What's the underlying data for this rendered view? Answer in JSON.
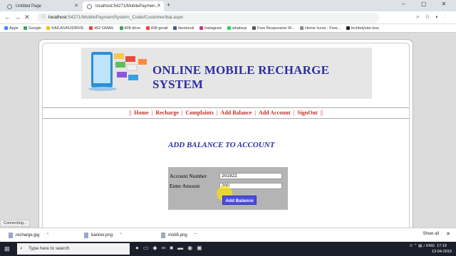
{
  "browser": {
    "tabs": [
      {
        "title": "Untitled Page",
        "active": false
      },
      {
        "title": "localhost:54271/MobilePaymen...",
        "active": true
      }
    ],
    "new_tab": "+",
    "window_controls": [
      "–",
      "▢",
      "✕"
    ],
    "url_host": "localhost",
    "url_rest": ":54271/MobilePaymentSystem_Code/Customer/bal.aspx",
    "nav_icons": [
      "search-icon",
      "star-icon",
      "extension-icon",
      "menu-icon"
    ],
    "bookmarks": [
      {
        "label": "Apps",
        "color": "#4285f4"
      },
      {
        "label": "Google",
        "color": "#34a853"
      },
      {
        "label": "KAILAS452DRIVE",
        "color": "#fbbc05"
      },
      {
        "label": "452 GMAIL",
        "color": "#ea4335"
      },
      {
        "label": "408 drive",
        "color": "#34a853"
      },
      {
        "label": "408 gmail",
        "color": "#ea4335"
      },
      {
        "label": "facebook",
        "color": "#3b5998"
      },
      {
        "label": "Instagram",
        "color": "#c13584"
      },
      {
        "label": "whatsup",
        "color": "#25d366"
      },
      {
        "label": "Free Responsive W...",
        "color": "#555555"
      },
      {
        "label": "Home Icons - Free...",
        "color": "#888888"
      },
      {
        "label": "techbrij/star-bus",
        "color": "#222222"
      }
    ]
  },
  "page": {
    "banner_title": "ONLINE MOBILE RECHARGE SYSTEM",
    "menu": [
      "Home",
      "Recharge",
      "Complaints",
      "Add Balance",
      "Add Account",
      "SignOut"
    ],
    "section_title": "ADD BALANCE TO ACCOUNT",
    "form": {
      "account_label": "Account Number",
      "account_value": "201922",
      "amount_label": "Enter Amount",
      "amount_value": "200",
      "submit_label": "Add Balance"
    },
    "accent": "#2c2ea5",
    "menu_color": "#c0302a",
    "button_color": "#4a4ee0"
  },
  "status": "Connecting...",
  "downloads": {
    "items": [
      "recharge.jpg",
      "banner.png",
      "mob5.png"
    ],
    "show_all": "Show all"
  },
  "taskbar": {
    "search_placeholder": "Type here to search",
    "tray_text": "ENG",
    "time": "17:19",
    "date": "13-04-2019"
  }
}
